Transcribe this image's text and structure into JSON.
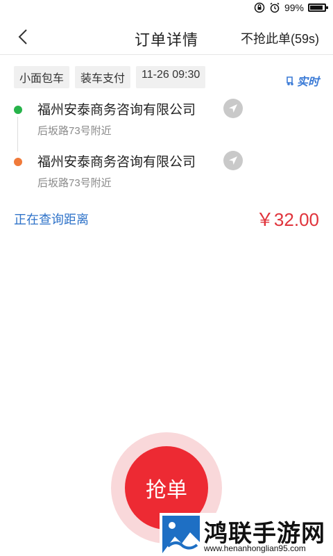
{
  "status_bar": {
    "battery": "99%",
    "battery_level": 0.99
  },
  "header": {
    "title": "订单详情",
    "action": "不抢此单(59s)"
  },
  "tags": [
    "小面包车",
    "装车支付",
    "11-26 09:30"
  ],
  "realtime_badge": "实时",
  "addresses": [
    {
      "name": "福州安泰商务咨询有限公司",
      "sub": "后坂路73号附近",
      "color": "#27b34a"
    },
    {
      "name": "福州安泰商务咨询有限公司",
      "sub": "后坂路73号附近",
      "color": "#f07a3a"
    }
  ],
  "distance_text": "正在查询距离",
  "price": "￥32.00",
  "grab_button": "抢单",
  "watermark": {
    "title": "鸿联手游网",
    "url": "www.henanhonglian95.com"
  },
  "colors": {
    "accent_red": "#ed2a33",
    "link_blue": "#2f73c9"
  }
}
